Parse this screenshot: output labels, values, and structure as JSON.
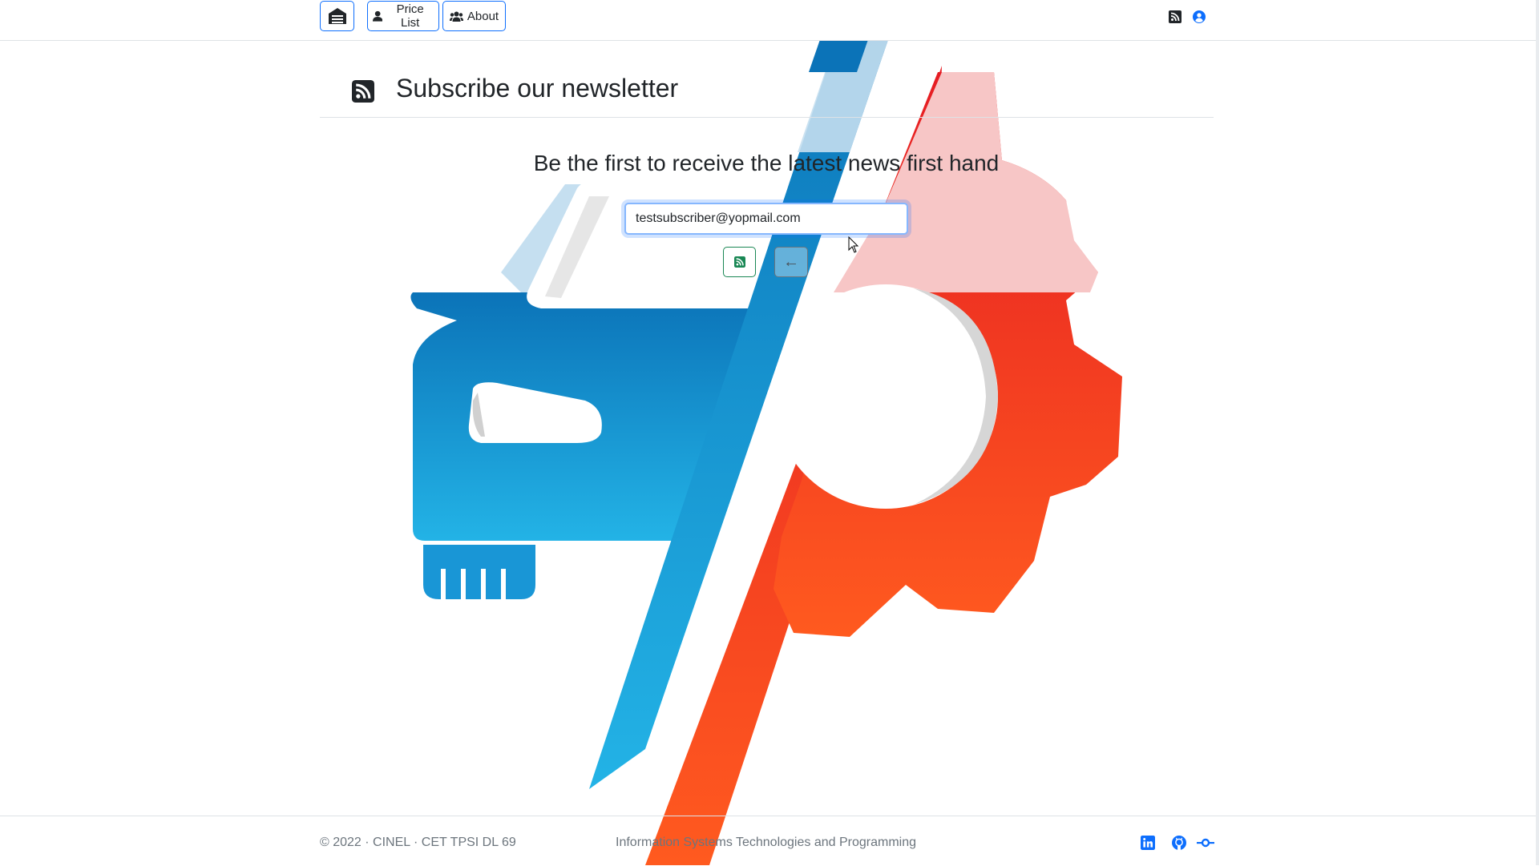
{
  "navbar": {
    "home_icon": "garage-icon",
    "price_list_label": "Price List",
    "about_label": "About",
    "rss_icon": "rss-icon",
    "user_icon": "user-circle-icon",
    "accent": "#0d6efd"
  },
  "main": {
    "title": "Subscribe our newsletter",
    "title_icon": "rss-square-icon",
    "lead": "Be the first to receive the latest news first hand",
    "email_value": "testsubscriber@yopmail.com",
    "subscribe_icon": "rss-icon",
    "back_label": "←"
  },
  "footer": {
    "copyright": "© 2022 · CINEL · CET TPSI DL 69",
    "program": "Information Systems Technologies and Programming",
    "icons": [
      "linkedin-icon",
      "github-icon",
      "git-commit-icon"
    ]
  },
  "colors": {
    "brand_blue": "#1b8fd2",
    "brand_red": "#ee3324",
    "success": "#198754"
  }
}
